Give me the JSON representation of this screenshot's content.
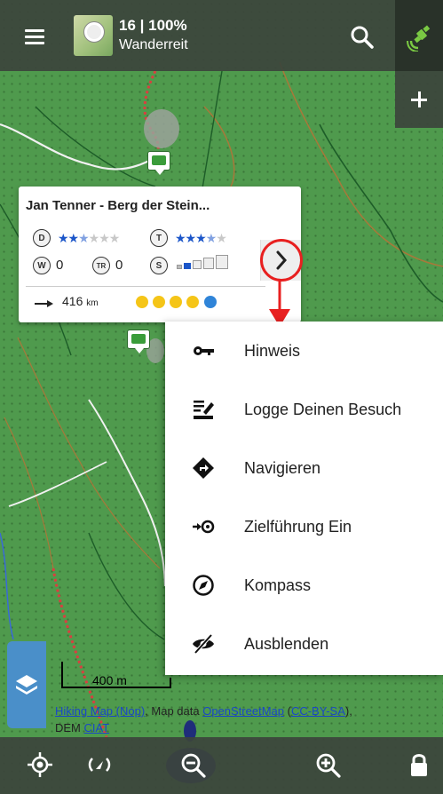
{
  "topbar": {
    "zoom_info": "16 | 100%",
    "map_name": "Wanderreit"
  },
  "popup": {
    "title": "Jan Tenner - Berg der Stein...",
    "difficulty_badge": "D",
    "terrain_badge": "T",
    "difficulty_stars": 2.5,
    "terrain_stars": 3.5,
    "waypoints_badge": "W",
    "waypoints_value": "0",
    "trackables_badge": "TR",
    "trackables_value": "0",
    "size_badge": "S",
    "distance_value": "416",
    "distance_unit": "km"
  },
  "menu": {
    "items": [
      {
        "label": "Hinweis",
        "icon": "key-icon"
      },
      {
        "label": "Logge Deinen Besuch",
        "icon": "log-visit-icon"
      },
      {
        "label": "Navigieren",
        "icon": "navigate-diamond-icon"
      },
      {
        "label": "Zielführung Ein",
        "icon": "guidance-icon"
      },
      {
        "label": "Kompass",
        "icon": "compass-icon"
      },
      {
        "label": "Ausblenden",
        "icon": "eye-off-icon"
      }
    ]
  },
  "map": {
    "scale_label": "400 m",
    "attribution": {
      "link1": "Hiking Map (Nop)",
      "text1": ", Map data ",
      "link2": "OpenStreetMap",
      "text2": " (",
      "link3": "CC-BY-SA",
      "text3": "),",
      "text4": "DEM ",
      "link4": "CIAT"
    }
  },
  "colors": {
    "accent_red": "#e82020",
    "star_blue": "#1c56c9",
    "layers_blue": "#4a8fc9",
    "map_green": "#4f9a4d"
  }
}
